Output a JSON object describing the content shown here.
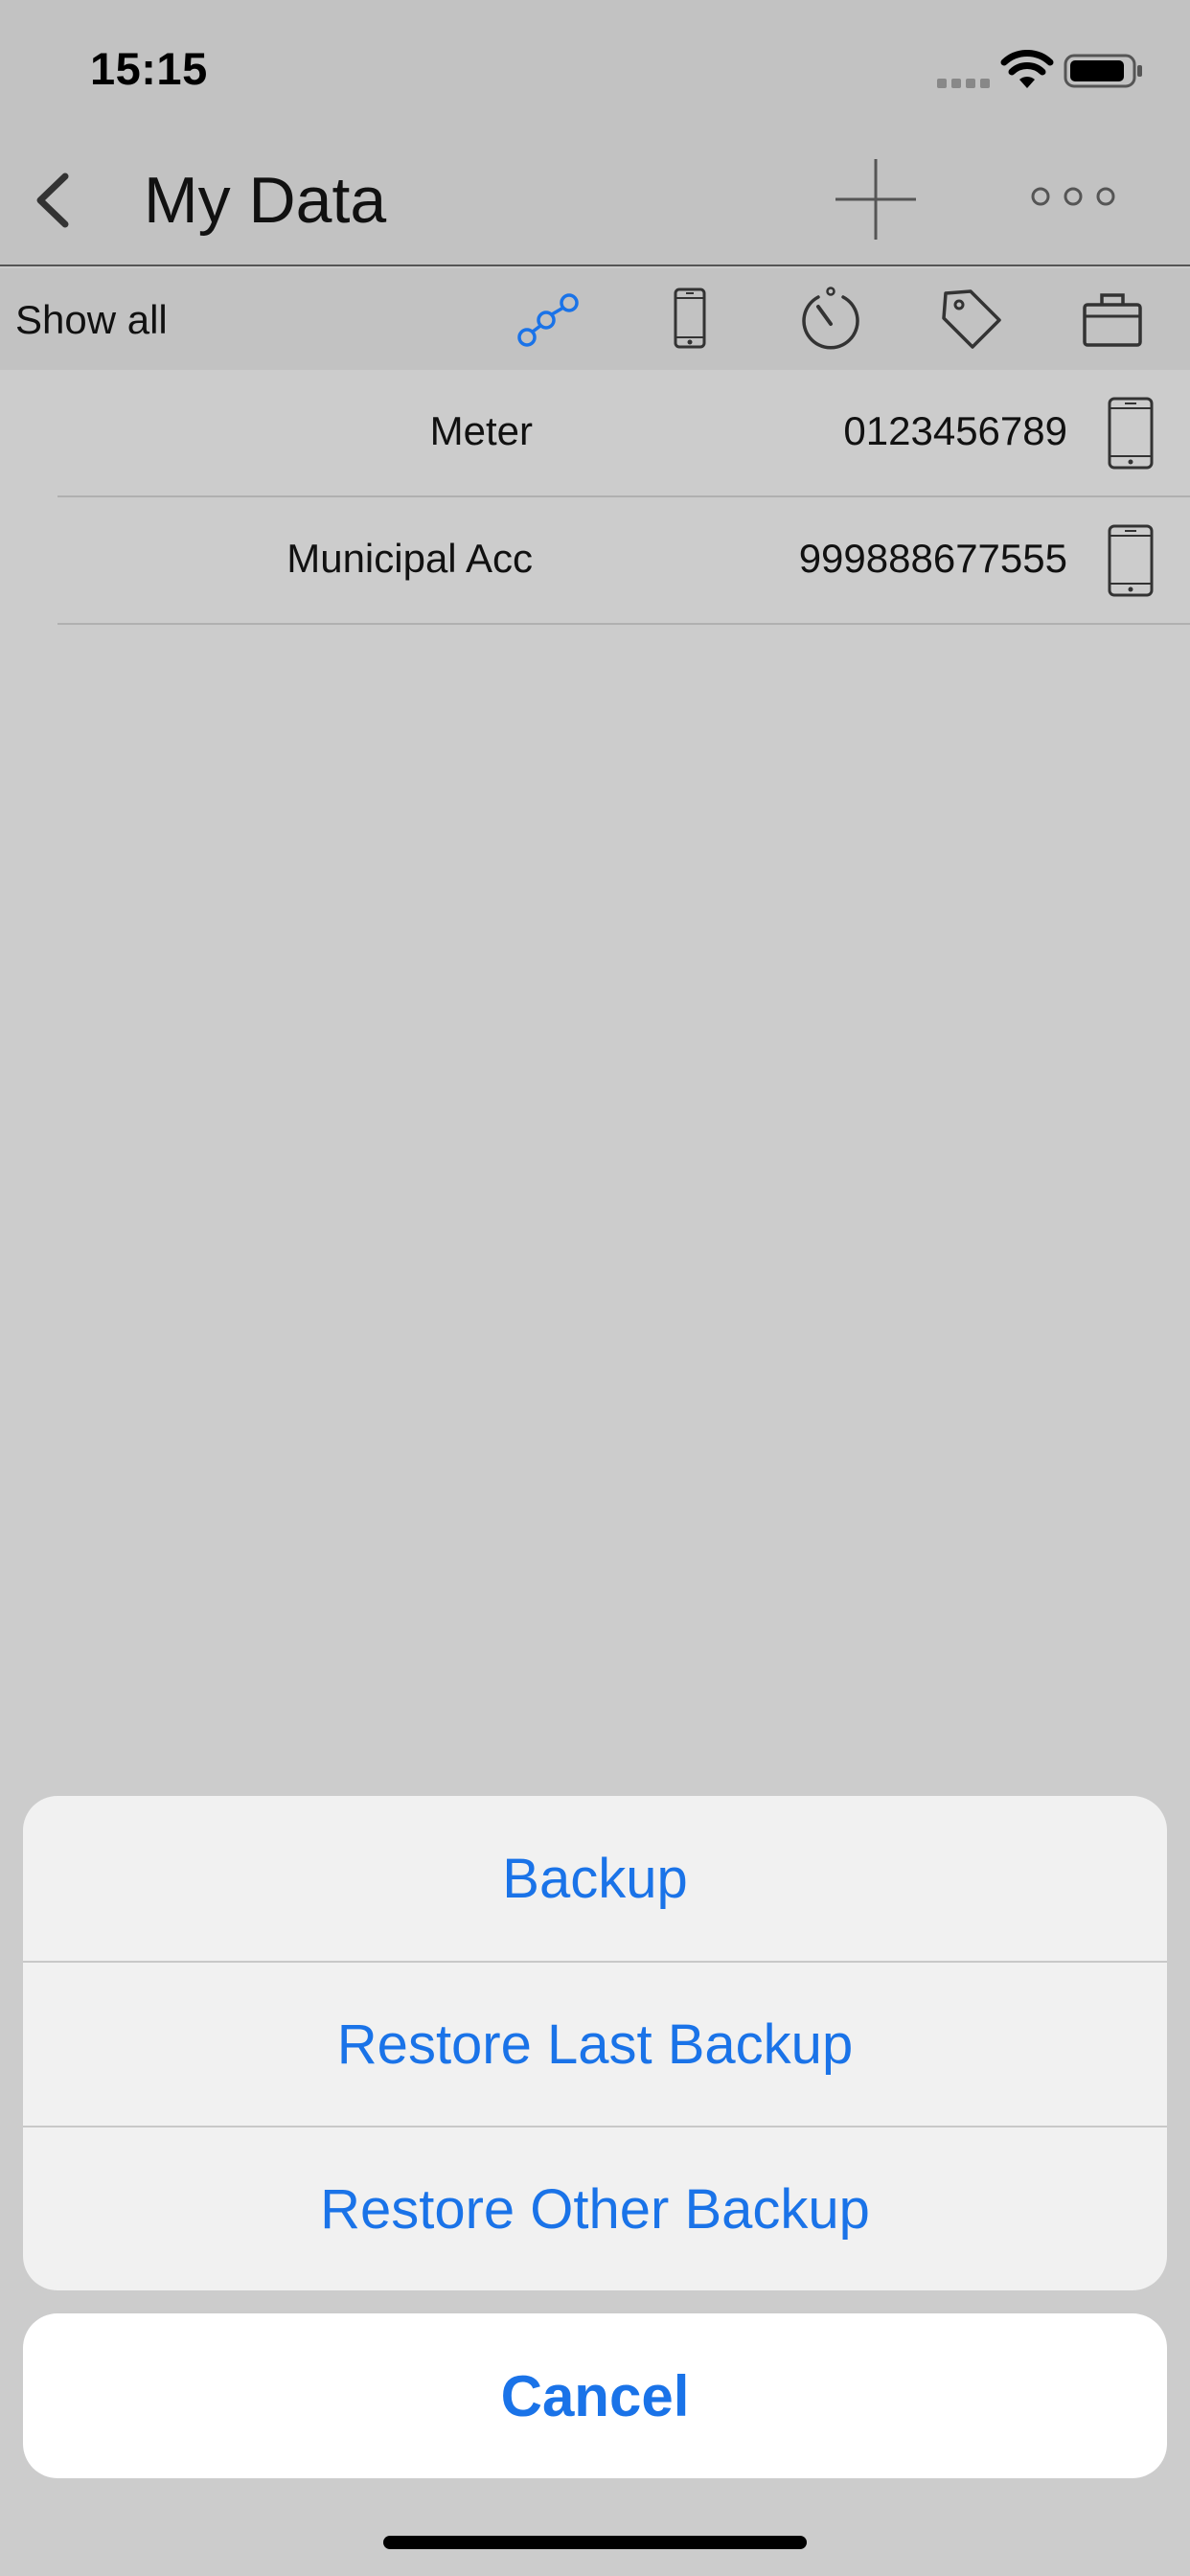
{
  "status_bar": {
    "time": "15:15"
  },
  "nav": {
    "title": "My Data",
    "back_icon": "chevron-left-icon",
    "add_icon": "plus-icon",
    "more_icon": "ellipsis-icon"
  },
  "filter_bar": {
    "show_all_label": "Show all",
    "filters": [
      {
        "icon": "nodes-icon",
        "selected": true
      },
      {
        "icon": "phone-icon",
        "selected": false
      },
      {
        "icon": "meter-icon",
        "selected": false
      },
      {
        "icon": "tag-icon",
        "selected": false
      },
      {
        "icon": "briefcase-icon",
        "selected": false
      }
    ]
  },
  "list": {
    "rows": [
      {
        "name": "Meter",
        "value": "0123456789",
        "icon": "phone-icon"
      },
      {
        "name": "Municipal Acc",
        "value": "999888677555",
        "icon": "phone-icon"
      }
    ]
  },
  "action_sheet": {
    "backup_label": "Backup",
    "restore_last_label": "Restore Last Backup",
    "restore_other_label": "Restore Other Backup",
    "cancel_label": "Cancel"
  },
  "colors": {
    "accent": "#1a73e8",
    "background": "#cccccc",
    "bar": "#c2c2c2"
  }
}
